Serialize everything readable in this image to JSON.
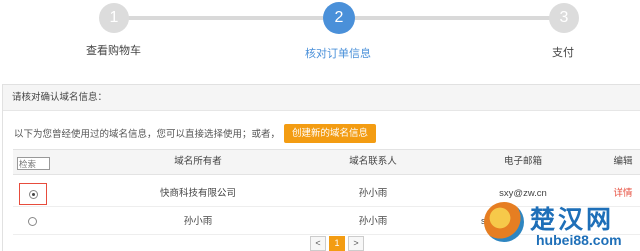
{
  "stepper": {
    "steps": [
      {
        "number": "1",
        "label": "查看购物车"
      },
      {
        "number": "2",
        "label": "核对订单信息"
      },
      {
        "number": "3",
        "label": "支付"
      }
    ],
    "active_color": "#4a90d9",
    "inactive_color": "#dcdcdc"
  },
  "panel": {
    "title": "请核对确认域名信息：",
    "hint": "以下为您曾经使用过的域名信息，您可以直接选择使用；或者，",
    "create_button": "创建新的域名信息",
    "accent_color": "#f39c12"
  },
  "table": {
    "search_placeholder": "检索",
    "headers": [
      "域名所有者",
      "域名联系人",
      "电子邮箱",
      "编辑"
    ],
    "rows": [
      {
        "selected": true,
        "owner": "快商科技有限公司",
        "contact": "孙小雨",
        "email": "sxy@zw.cn",
        "action": "详情"
      },
      {
        "selected": false,
        "owner": "孙小雨",
        "contact": "孙小雨",
        "email": "sun",
        "action": ""
      }
    ]
  },
  "pager": {
    "prev": "<",
    "current": "1",
    "next": ">"
  },
  "watermark": {
    "title": "楚汉网",
    "url": "hubei88.com"
  }
}
